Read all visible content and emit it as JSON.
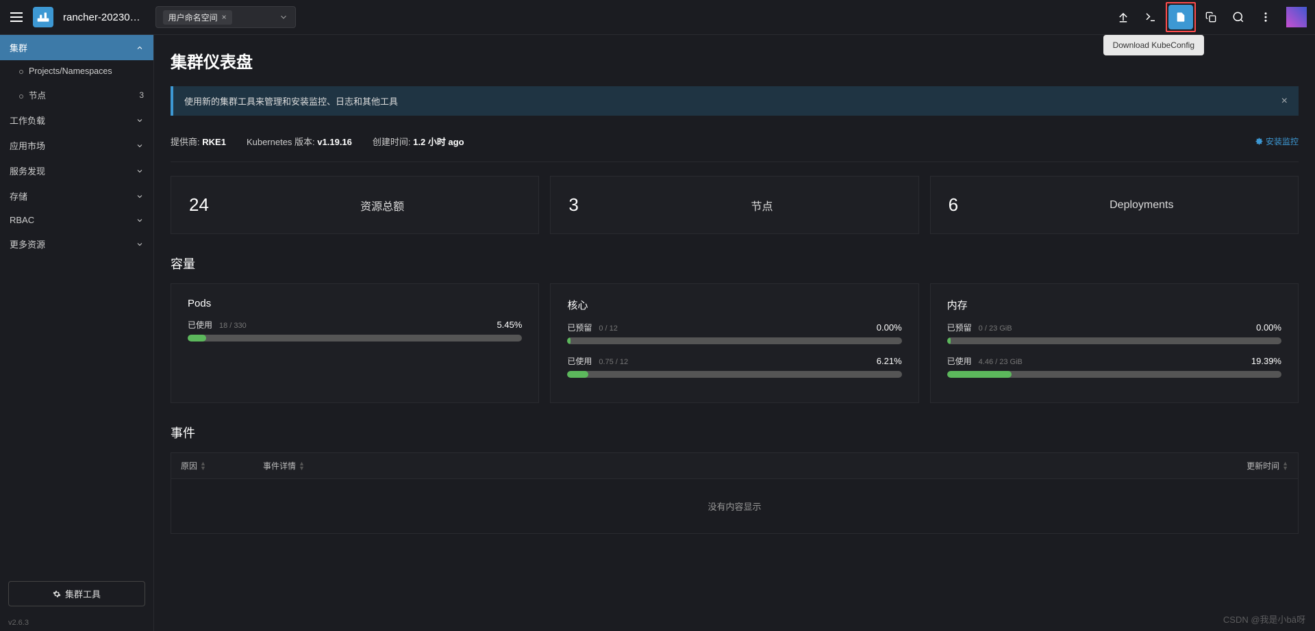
{
  "topbar": {
    "brand_name": "rancher-20230…",
    "namespace_tag": "用户命名空间",
    "tooltip": "Download KubeConfig"
  },
  "sidebar": {
    "active": "集群",
    "items": [
      {
        "label": "集群",
        "type": "top-active"
      },
      {
        "label": "Projects/Namespaces",
        "type": "sub"
      },
      {
        "label": "节点",
        "type": "sub",
        "count": "3"
      },
      {
        "label": "工作负载",
        "type": "group"
      },
      {
        "label": "应用市场",
        "type": "group"
      },
      {
        "label": "服务发现",
        "type": "group"
      },
      {
        "label": "存储",
        "type": "group"
      },
      {
        "label": "RBAC",
        "type": "group"
      },
      {
        "label": "更多资源",
        "type": "group"
      }
    ],
    "cluster_tools": "集群工具",
    "version": "v2.6.3"
  },
  "page": {
    "title": "集群仪表盘",
    "banner_text": "使用新的集群工具来管理和安装监控、日志和其他工具",
    "provider_label": "提供商:",
    "provider_value": "RKE1",
    "k8s_label": "Kubernetes 版本:",
    "k8s_value": "v1.19.16",
    "created_label": "创建时间:",
    "created_value": "1.2 小时 ago",
    "install_monitoring": "安装监控"
  },
  "stats": [
    {
      "num": "24",
      "label": "资源总额"
    },
    {
      "num": "3",
      "label": "节点"
    },
    {
      "num": "6",
      "label": "Deployments"
    }
  ],
  "capacity": {
    "title": "容量",
    "cards": [
      {
        "title": "Pods",
        "metrics": [
          {
            "label": "已使用",
            "detail": "18 / 330",
            "pct": "5.45%",
            "width": 5.45
          }
        ]
      },
      {
        "title": "核心",
        "metrics": [
          {
            "label": "已预留",
            "detail": "0 / 12",
            "pct": "0.00%",
            "width": 0
          },
          {
            "label": "已使用",
            "detail": "0.75 / 12",
            "pct": "6.21%",
            "width": 6.21
          }
        ]
      },
      {
        "title": "内存",
        "metrics": [
          {
            "label": "已预留",
            "detail": "0 / 23 GiB",
            "pct": "0.00%",
            "width": 0
          },
          {
            "label": "已使用",
            "detail": "4.46 / 23 GiB",
            "pct": "19.39%",
            "width": 19.39
          }
        ]
      }
    ]
  },
  "events": {
    "title": "事件",
    "col_reason": "原因",
    "col_message": "事件详情",
    "col_updated": "更新时间",
    "empty": "没有内容显示"
  },
  "watermark": "CSDN @我是小bā呀"
}
